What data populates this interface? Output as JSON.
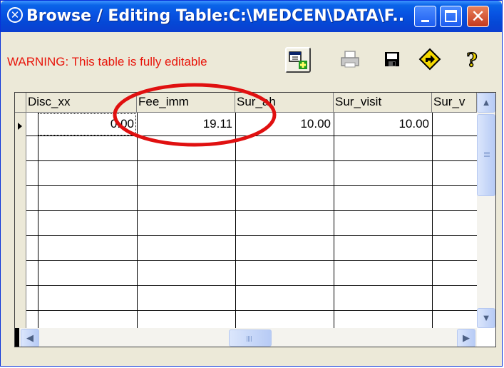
{
  "window": {
    "title": "Browse / Editing Table:C:\\MEDCEN\\DATA\\F...",
    "app_icon": "medcen-logo-icon",
    "controls": {
      "minimize": "minimize-icon",
      "maximize": "maximize-icon",
      "close": "✕"
    }
  },
  "toolbar": {
    "warning": "WARNING: This table is fully editable",
    "warning_color": "#e8150b",
    "buttons": [
      {
        "icon": "add-record-icon"
      },
      {
        "icon": "printer-icon"
      },
      {
        "icon": "floppy-save-icon"
      },
      {
        "icon": "go-arrow-icon"
      },
      {
        "icon": "help-question-icon"
      }
    ]
  },
  "grid": {
    "columns": [
      "Disc_xx",
      "Fee_imm",
      "Sur_ah",
      "Sur_visit",
      "Sur_v"
    ],
    "rows": [
      [
        "0.00",
        "19.11",
        "10.00",
        "10.00",
        ""
      ]
    ],
    "current_row": 0
  },
  "annotation": {
    "shape": "ellipse",
    "color": "#e01010",
    "highlights": "Fee_imm column"
  }
}
